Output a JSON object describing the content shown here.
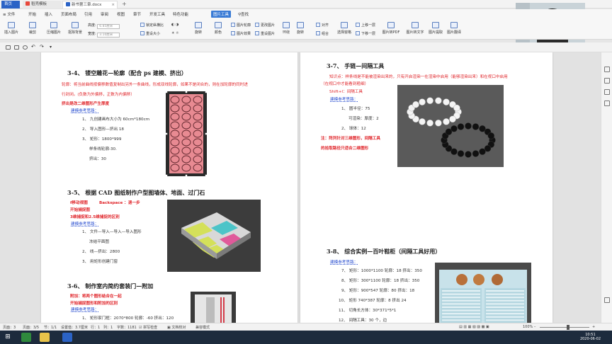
{
  "tabs": {
    "home": "首页",
    "tab1": "稻壳模板",
    "tab2": "新书第三章.docx"
  },
  "menu": {
    "file": "文件",
    "items": [
      "开始",
      "插入",
      "页面布局",
      "引用",
      "审阅",
      "视图",
      "章节",
      "开发工具",
      "特色功能",
      "图片工具"
    ],
    "search": "查找"
  },
  "ribbon": {
    "insert_pic": "插入图片",
    "crop": "裁剪",
    "compress": "压缩图片",
    "clear_bg": "抠除背景",
    "height_label": "高度:",
    "height_value": "6.85厘米",
    "width_label": "宽度:",
    "width_value": "3.10厘米",
    "lock_ratio": "锁定纵横比",
    "reset_size": "重设大小",
    "rotate_btn": "旋转",
    "color": "颜色",
    "border": "图片轮廓",
    "effect": "图片效果",
    "change_pic": "更改图片",
    "reset_pic": "重设图片",
    "wrap": "环绕",
    "rotate": "旋转",
    "align": "对齐",
    "combine": "组合",
    "select_pane": "选择窗格",
    "up": "上移一层",
    "down": "下移一层",
    "pdf": "图片转PDF",
    "to_text": "图片转文字",
    "extract": "图片提取",
    "translate": "图片翻译",
    "contrast": "对比度",
    "brightness": "亮度"
  },
  "page_left": {
    "s34_title": "3-4、 镂空雕花—轮廓（配合 ps 建模、挤出）",
    "s34_line1": "轮廓：将当前曲线按偏移数值复制出另外一条曲线，形成双线轮廓，如果不是闭合的，则在加轮廓的同时进",
    "s34_line2": "行封闭。(负数为外偏移，正数为内偏移）",
    "s34_red": "挤出是改二维图形产生厚度",
    "s34_ideas": "建模参考思路：",
    "s34_steps": [
      "1、 九创建画布大小为 60cm*180cm",
      "2、 导入图形—挤出 18",
      "3、 矩形：1800*999",
      "样条线轮廓-30.",
      "挤出：30"
    ],
    "s35_title": "3-5、 根据 CAD 图纸制作户型图墙体、地面、过门石",
    "s35_red1": "f移动视图",
    "s35_red1b": "Backspace ：退一步",
    "s35_red2": "开始捕捉图",
    "s35_red3": "3维捕捉和2.5维捕捉的区别",
    "s35_ideas": "建模参考思路：",
    "s35_steps": [
      "1、 文件—导入—导入—导入图形",
      "冻结平面图",
      "2、 线—挤出：2800",
      "3、 用矩形创建门窗"
    ],
    "s36_title": "3-6、 制作室内简约套装门—附加",
    "s36_red1": "附加：将两个图形结合在一起",
    "s36_red2": "开始捕捉图形和附加的区别",
    "s36_ideas": "建模参考思路：",
    "s36_step1": "1、 矩形家门框：2070*800 轮廓：-60 挤出：120"
  },
  "page_right": {
    "s37_title": "3-7、 手链—间隔工具",
    "s37_red1": "知识点：样条线是不能被渲染出来的，只有开启渲染一在渲染中启用（能够渲染出来）和在视口中启用",
    "s37_red2": "（在视口中才能看到粗细）",
    "s37_short": "Shift+I：间隔工具",
    "s37_ideas": "建模参考思路：",
    "s37_steps": [
      "1、 圆半径：75",
      "可渲染：厚度：2",
      "2、 球体：12"
    ],
    "s37_note1": "注：阵列针对三维图形，间隔工具",
    "s37_note2": "的拾取路径只适合二维图形",
    "s38_title": "3-8、 综合实例—百叶鞋柜（间隔工具好用）",
    "s38_ideas": "建模参考思路：",
    "s38_steps": [
      "7、 矩形：1000*1100 轮廓：18 挤出：350",
      "8、 矩形：300*1100 轮廓：18 挤出：350",
      "9、 矩形：900*547 轮廓：80 挤出：18",
      "10、 矩形 740*387 轮廓：8 挤出 24",
      "11、 切角长方体：30*371*5*1",
      "12、 间隔工具：30 个，边"
    ]
  },
  "status": {
    "page": "页面：3",
    "pages": "页面：3/5",
    "section": "节：1/1",
    "setting": "设置值：3.7厘米",
    "row": "行：1",
    "col": "列：1",
    "words": "字数：1181",
    "spell": "拼写检查",
    "proof": "文档校对",
    "compat": "兼容模式",
    "zoom": "100%"
  },
  "clock": {
    "time": "10:51",
    "date": "2020-06-02"
  },
  "colors": {
    "accent": "#3a7bd5",
    "red_text": "#e0262b",
    "blue_text": "#2a4fd0"
  }
}
